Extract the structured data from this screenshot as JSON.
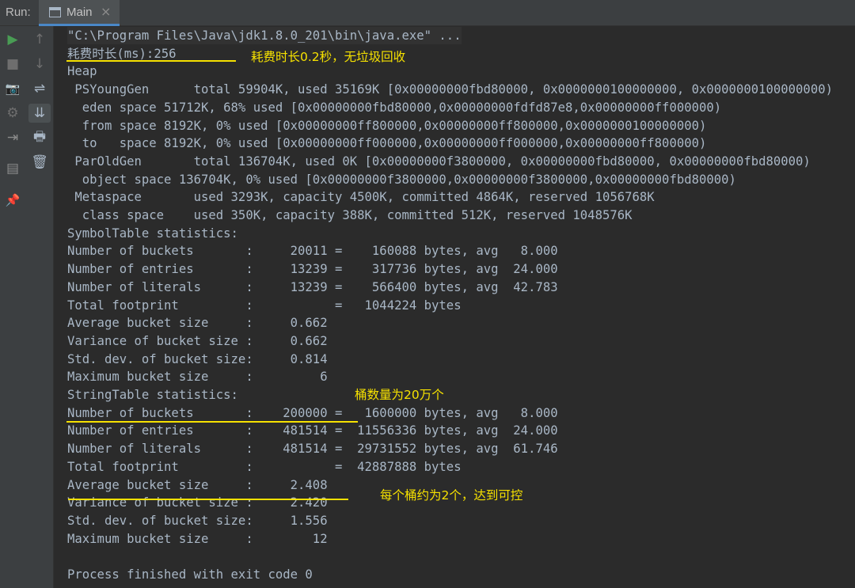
{
  "topbar": {
    "run_label": "Run:",
    "tab_title": "Main",
    "tab_close": "×"
  },
  "toolbar": {
    "rerun": "▶",
    "up": "↑",
    "stop": "■",
    "down": "↓",
    "camera": "📷",
    "wrap": "⇌",
    "settings": "⚙",
    "scroll_end": "⇊",
    "exit": "⇥",
    "print": "🖶",
    "layout": "▤",
    "trash": "🗑",
    "pin": "📌"
  },
  "console": {
    "lines": [
      "\"C:\\Program Files\\Java\\jdk1.8.0_201\\bin\\java.exe\" ...",
      "耗费时长(ms):256",
      "Heap",
      " PSYoungGen      total 59904K, used 35169K [0x00000000fbd80000, 0x0000000100000000, 0x0000000100000000)",
      "  eden space 51712K, 68% used [0x00000000fbd80000,0x00000000fdfd87e8,0x00000000ff000000)",
      "  from space 8192K, 0% used [0x00000000ff800000,0x00000000ff800000,0x0000000100000000)",
      "  to   space 8192K, 0% used [0x00000000ff000000,0x00000000ff000000,0x00000000ff800000)",
      " ParOldGen       total 136704K, used 0K [0x00000000f3800000, 0x00000000fbd80000, 0x00000000fbd80000)",
      "  object space 136704K, 0% used [0x00000000f3800000,0x00000000f3800000,0x00000000fbd80000)",
      " Metaspace       used 3293K, capacity 4500K, committed 4864K, reserved 1056768K",
      "  class space    used 350K, capacity 388K, committed 512K, reserved 1048576K",
      "SymbolTable statistics:",
      "Number of buckets       :     20011 =    160088 bytes, avg   8.000",
      "Number of entries       :     13239 =    317736 bytes, avg  24.000",
      "Number of literals      :     13239 =    566400 bytes, avg  42.783",
      "Total footprint         :           =   1044224 bytes",
      "Average bucket size     :     0.662",
      "Variance of bucket size :     0.662",
      "Std. dev. of bucket size:     0.814",
      "Maximum bucket size     :         6",
      "StringTable statistics:",
      "Number of buckets       :    200000 =   1600000 bytes, avg   8.000",
      "Number of entries       :    481514 =  11556336 bytes, avg  24.000",
      "Number of literals      :    481514 =  29731552 bytes, avg  61.746",
      "Total footprint         :           =  42887888 bytes",
      "Average bucket size     :     2.408",
      "Variance of bucket size :     2.420",
      "Std. dev. of bucket size:     1.556",
      "Maximum bucket size     :        12",
      "",
      "Process finished with exit code 0"
    ]
  },
  "annotations": {
    "time_note": "耗费时长0.2秒，无垃圾回收",
    "buckets_note": "桶数量为20万个",
    "avg_note": "每个桶约为2个，达到可控"
  },
  "colors": {
    "console_text": "#a9b7c6",
    "annotation": "#f6e100",
    "run_green": "#499c54",
    "tab_underline": "#4a88c7"
  }
}
